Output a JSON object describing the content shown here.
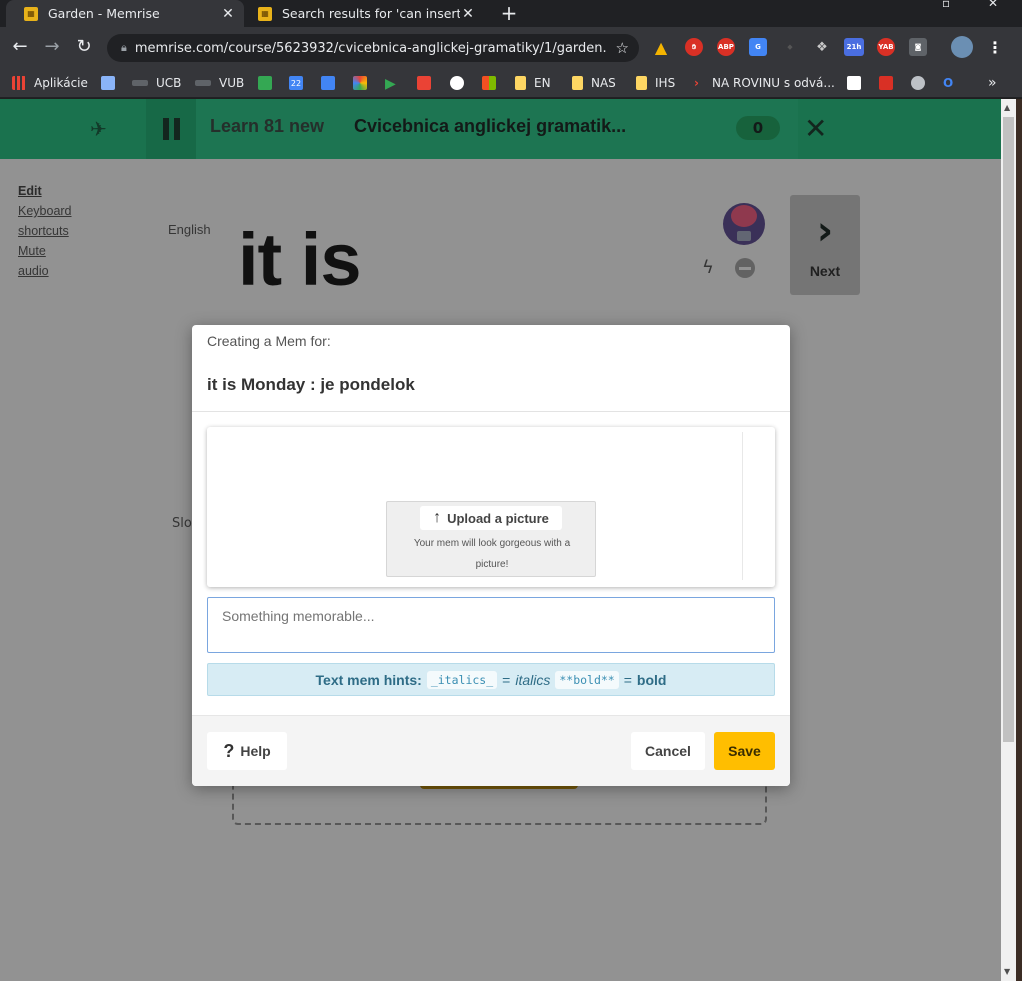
{
  "browser": {
    "tabs": [
      {
        "title": "Garden - Memrise",
        "active": true
      },
      {
        "title": "Search results for 'can insert pictu",
        "active": false
      }
    ],
    "url": "memrise.com/course/5623932/cvicebnica-anglickej-gramatiky/1/garden...",
    "bookmarks": {
      "apps": "Aplikácie",
      "ucb": "UCB",
      "vub": "VUB",
      "calendar_num": "22",
      "en": "EN",
      "nas": "NAS",
      "ihs": "IHS",
      "na_rovinu": "NA ROVINU s odvá..."
    },
    "ext_badges": {
      "abp": "ABP",
      "yab": "YAB",
      "cal": "21h"
    }
  },
  "app": {
    "learn_label": "Learn 81 new",
    "course_title": "Cvicebnica anglickej gramatik...",
    "count": "0",
    "left_links": [
      "Edit",
      "Keyboard",
      "shortcuts",
      "Mute",
      "audio"
    ],
    "language_label": "English",
    "word": "it is",
    "side_label": "Slo",
    "next_label": "Next"
  },
  "modal": {
    "subtitle": "Creating a Mem for:",
    "heading": "it is Monday : je pondelok",
    "upload_label": "Upload a picture",
    "upload_desc": "Your mem will look gorgeous with a picture!",
    "mem_placeholder": "Something memorable...",
    "hints": {
      "label": "Text mem hints:",
      "italics_code": "_italics_",
      "equals": "=",
      "italics_text": "italics",
      "bold_code": "**bold**",
      "bold_text": "bold"
    },
    "help_label": "Help",
    "cancel_label": "Cancel",
    "save_label": "Save"
  },
  "colors": {
    "brand_green": "#2ab27b",
    "save_yellow": "#ffbe00",
    "hint_bg": "#d7ecf4"
  }
}
